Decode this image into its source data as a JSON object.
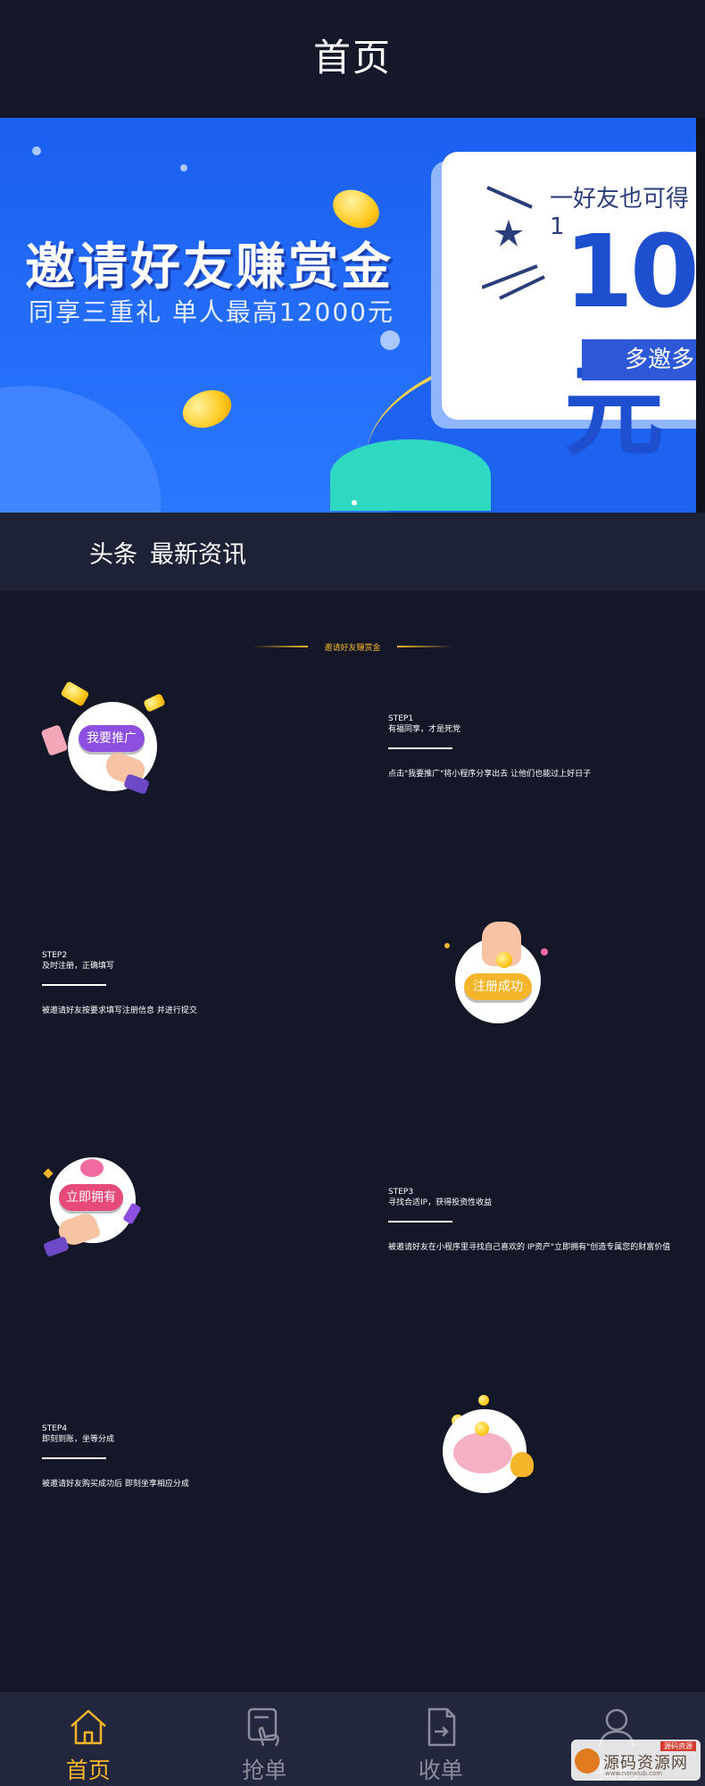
{
  "header": {
    "title": "首页"
  },
  "banner": {
    "title": "邀请好友赚赏金",
    "subtitle": "同享三重礼  单人最高12000元",
    "card_heading": "一好友也可得1",
    "card_amount": "10元",
    "card_button": "多邀多"
  },
  "news": {
    "label": "头条",
    "text": "最新资讯"
  },
  "section": {
    "title": "邀请好友赚赏金"
  },
  "steps": [
    {
      "no": "STEP1",
      "subtitle": "有福同享，才是死党",
      "desc": "点击\"我要推广\"将小程序分享出去 让他们也能过上好日子",
      "illus_label": "我要推广"
    },
    {
      "no": "STEP2",
      "subtitle": "及时注册，正确填写",
      "desc": "被邀请好友按要求填写注册信息 并进行提交",
      "illus_label": "注册成功"
    },
    {
      "no": "STEP3",
      "subtitle": "寻找合适IP，获得投资性收益",
      "desc": "被邀请好友在小程序里寻找自己喜欢的 IP资产\"立即拥有\"创造专属您的财富价值",
      "illus_label": "立即拥有"
    },
    {
      "no": "STEP4",
      "subtitle": "即刻到账，坐等分成",
      "desc": "被邀请好友购买成功后 即刻坐享相应分成",
      "illus_label": ""
    }
  ],
  "tabbar": {
    "active_color": "#f5b52a",
    "inactive_color": "#8a8d9c",
    "items": [
      {
        "label": "首页",
        "icon": "home-icon",
        "active": true
      },
      {
        "label": "抢单",
        "icon": "grab-order-icon",
        "active": false
      },
      {
        "label": "收单",
        "icon": "receive-order-icon",
        "active": false
      },
      {
        "label": "我的",
        "icon": "user-icon",
        "active": false
      }
    ]
  },
  "watermark": {
    "text": "源码资源网",
    "badge": "源码资源",
    "url": "www.nonxiub.com"
  }
}
